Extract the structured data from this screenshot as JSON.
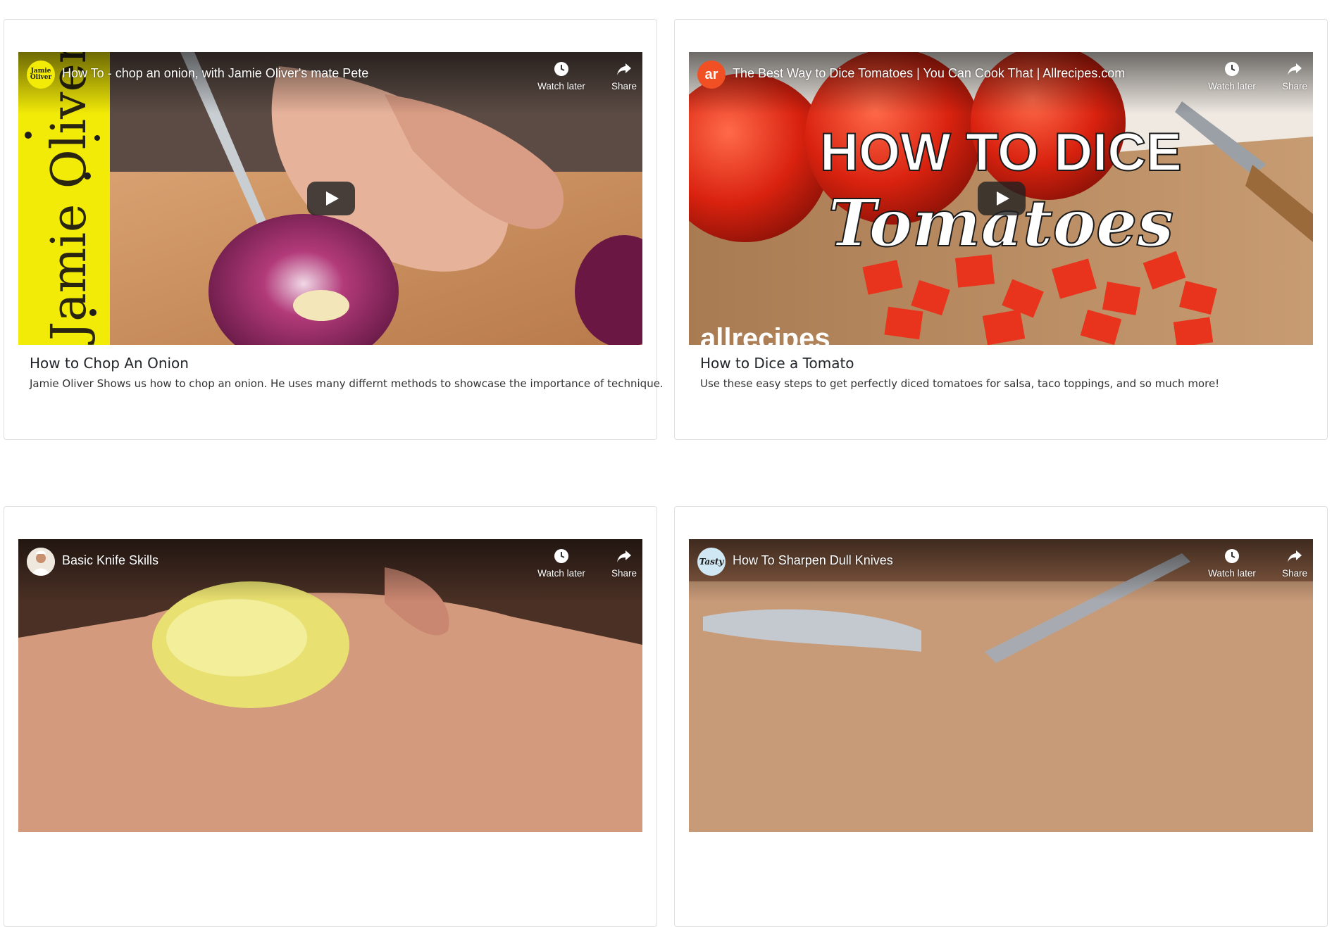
{
  "videos": [
    {
      "player_title": "How To - chop an onion, with Jamie Oliver's mate Pete",
      "channel": "Jamie Oliver",
      "watch_later": "Watch later",
      "share": "Share",
      "card_title": "How to Chop An Onion",
      "card_text": "Jamie Oliver Shows us how to chop an onion. He uses many differnt methods to showcase the importance of technique.",
      "thumb_text": "Jamie Oliver"
    },
    {
      "player_title": "The Best Way to Dice Tomatoes | You Can Cook That | Allrecipes.com",
      "channel": "ar",
      "watch_later": "Watch later",
      "share": "Share",
      "card_title": "How to Dice a Tomato",
      "card_text": "Use these easy steps to get perfectly diced tomatoes for salsa, taco toppings, and so much more!",
      "thumb_text_1": "HOW TO DICE",
      "thumb_text_2": "Tomatoes",
      "thumb_text_3": "allrecipes"
    },
    {
      "player_title": "Basic Knife Skills",
      "channel": "",
      "watch_later": "Watch later",
      "share": "Share",
      "card_title": "",
      "card_text": ""
    },
    {
      "player_title": "How To Sharpen Dull Knives",
      "channel": "Tasty",
      "watch_later": "Watch later",
      "share": "Share",
      "card_title": "",
      "card_text": ""
    }
  ],
  "colors": {
    "card_border": "#dfdfdf",
    "title_text": "#212529",
    "body_text": "#333333",
    "jamie_yellow": "#f2ea07",
    "allrecipes_orange": "#f15025"
  }
}
